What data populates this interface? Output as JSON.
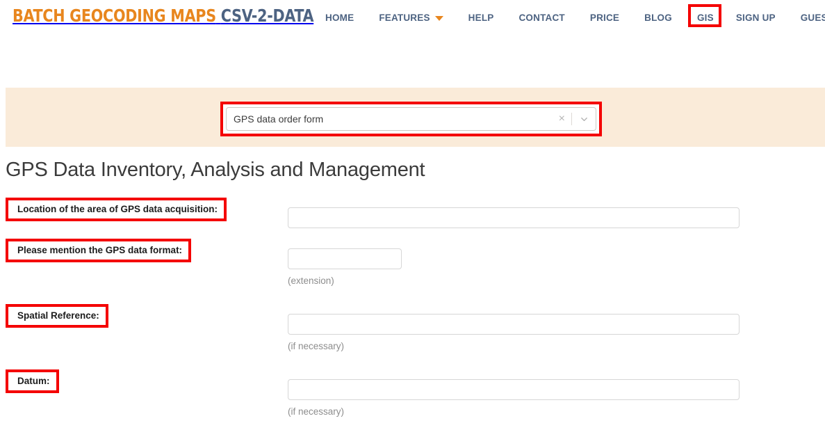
{
  "brand": {
    "part1": "BATCH GEOCODING MAPS",
    "part2": "CSV-2-DATA"
  },
  "nav": {
    "items": [
      {
        "label": "HOME",
        "name": "nav-item-home",
        "caret": false
      },
      {
        "label": "FEATURES",
        "name": "nav-item-features",
        "caret": true
      },
      {
        "label": "HELP",
        "name": "nav-item-help",
        "caret": false
      },
      {
        "label": "CONTACT",
        "name": "nav-item-contact",
        "caret": false
      },
      {
        "label": "PRICE",
        "name": "nav-item-price",
        "caret": false
      },
      {
        "label": "BLOG",
        "name": "nav-item-blog",
        "caret": false
      }
    ],
    "gis": "GIS",
    "signup": "SIGN UP",
    "guest": "GUEST"
  },
  "search": {
    "selected_value": "GPS data order form",
    "clear_glyph": "×"
  },
  "page": {
    "title": "GPS Data Inventory, Analysis and Management"
  },
  "form": {
    "fields": [
      {
        "label": "Location of the area of GPS data acquisition:",
        "value": "",
        "hint": "",
        "input_width": "wide"
      },
      {
        "label": "Please mention the GPS data format:",
        "value": "",
        "hint": "(extension)",
        "input_width": "narrow"
      },
      {
        "label": "Spatial Reference:",
        "value": "",
        "hint": "(if necessary)",
        "input_width": "wide"
      },
      {
        "label": "Datum:",
        "value": "",
        "hint": "(if necessary)",
        "input_width": "wide"
      }
    ]
  },
  "colors": {
    "brand_orange": "#e8861e",
    "brand_slate": "#4d6382",
    "annotation_red": "#f40000",
    "banner_beige": "#faebd9"
  }
}
